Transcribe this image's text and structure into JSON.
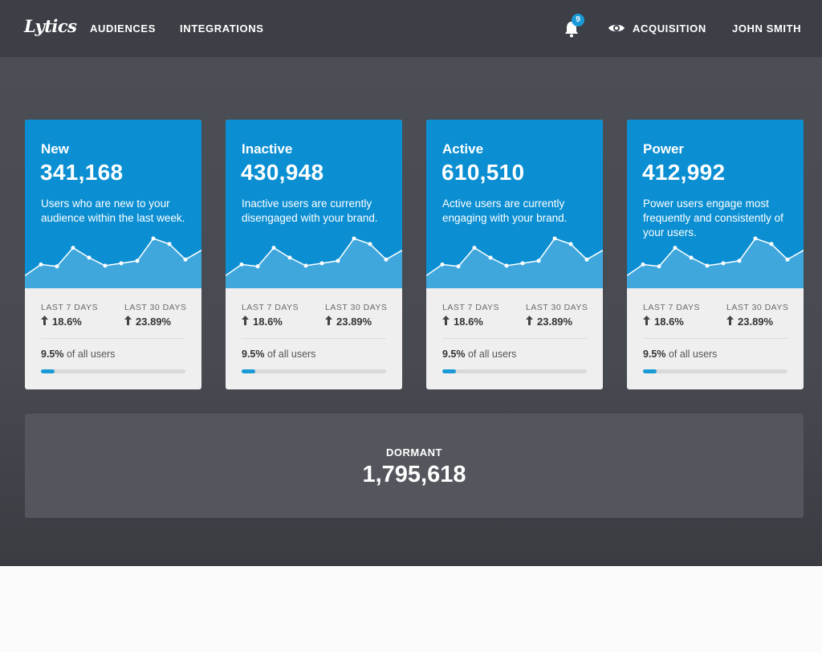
{
  "app": {
    "logo_text": "Lytics"
  },
  "nav": {
    "audiences": "AUDIENCES",
    "integrations": "INTEGRATIONS",
    "notifications_count": "9",
    "acquisition": "ACQUISITION",
    "user_name": "JOHN SMITH"
  },
  "colors": {
    "accent": "#0b8fd2",
    "header": "#3c3f46",
    "card_footer": "#efefef"
  },
  "stat_labels": {
    "last7": "LAST 7 DAYS",
    "last30": "LAST 30 DAYS",
    "all_users_suffix": "of all users"
  },
  "cards": [
    {
      "name": "New",
      "count": "341,168",
      "description": "Users who are new to your audience within the last week.",
      "last7": "18.6%",
      "last30": "23.89%",
      "share": "9.5%",
      "share_fraction": 0.095
    },
    {
      "name": "Inactive",
      "count": "430,948",
      "description": "Inactive users are currently disengaged with your brand.",
      "last7": "18.6%",
      "last30": "23.89%",
      "share": "9.5%",
      "share_fraction": 0.095
    },
    {
      "name": "Active",
      "count": "610,510",
      "description": "Active users are currently engaging with your brand.",
      "last7": "18.6%",
      "last30": "23.89%",
      "share": "9.5%",
      "share_fraction": 0.095
    },
    {
      "name": "Power",
      "count": "412,992",
      "description": "Power users engage most frequently and consistently of your users.",
      "last7": "18.6%",
      "last30": "23.89%",
      "share": "9.5%",
      "share_fraction": 0.095
    }
  ],
  "sparkline_values": [
    10,
    28,
    25,
    55,
    39,
    26,
    30,
    34,
    70,
    61,
    36,
    51
  ],
  "dormant": {
    "label": "DORMANT",
    "count": "1,795,618"
  }
}
